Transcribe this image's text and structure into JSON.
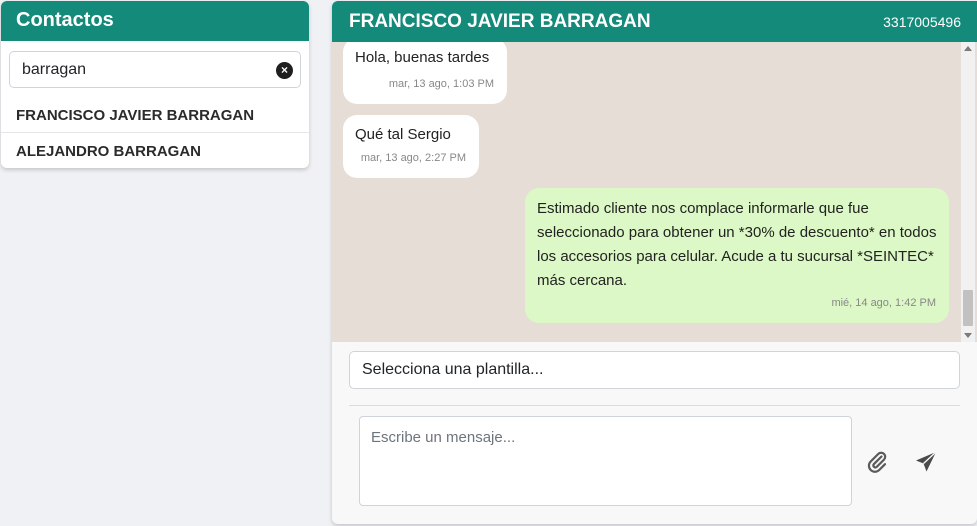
{
  "contacts": {
    "title": "Contactos",
    "search": {
      "value": "barragan"
    },
    "items": [
      {
        "label": "FRANCISCO JAVIER BARRAGAN"
      },
      {
        "label": "ALEJANDRO BARRAGAN"
      }
    ]
  },
  "chat": {
    "name": "FRANCISCO JAVIER BARRAGAN",
    "phone": "3317005496",
    "messages": [
      {
        "text": "Hola, buenas tardes",
        "time": "mar, 13 ago, 1:03 PM",
        "direction": "in"
      },
      {
        "text": "Qué tal Sergio",
        "time": "mar, 13 ago, 2:27 PM",
        "direction": "in"
      },
      {
        "text": "Estimado cliente nos complace informarle que fue seleccionado para obtener un *30% de descuento* en todos los accesorios para celular. Acude a tu sucursal *SEINTEC* más cercana.",
        "time": "mié, 14 ago, 1:42 PM",
        "direction": "out"
      }
    ],
    "template_select": {
      "value": "Selecciona una plantilla..."
    },
    "composer": {
      "placeholder": "Escribe un mensaje..."
    }
  },
  "icons": {
    "clear": "clear-icon",
    "attach": "paperclip-icon",
    "send": "send-icon"
  },
  "colors": {
    "header": "#138a7a",
    "chat_background": "#e6ddd6",
    "outgoing_bubble": "#dcf8c6",
    "incoming_bubble": "#ffffff"
  }
}
